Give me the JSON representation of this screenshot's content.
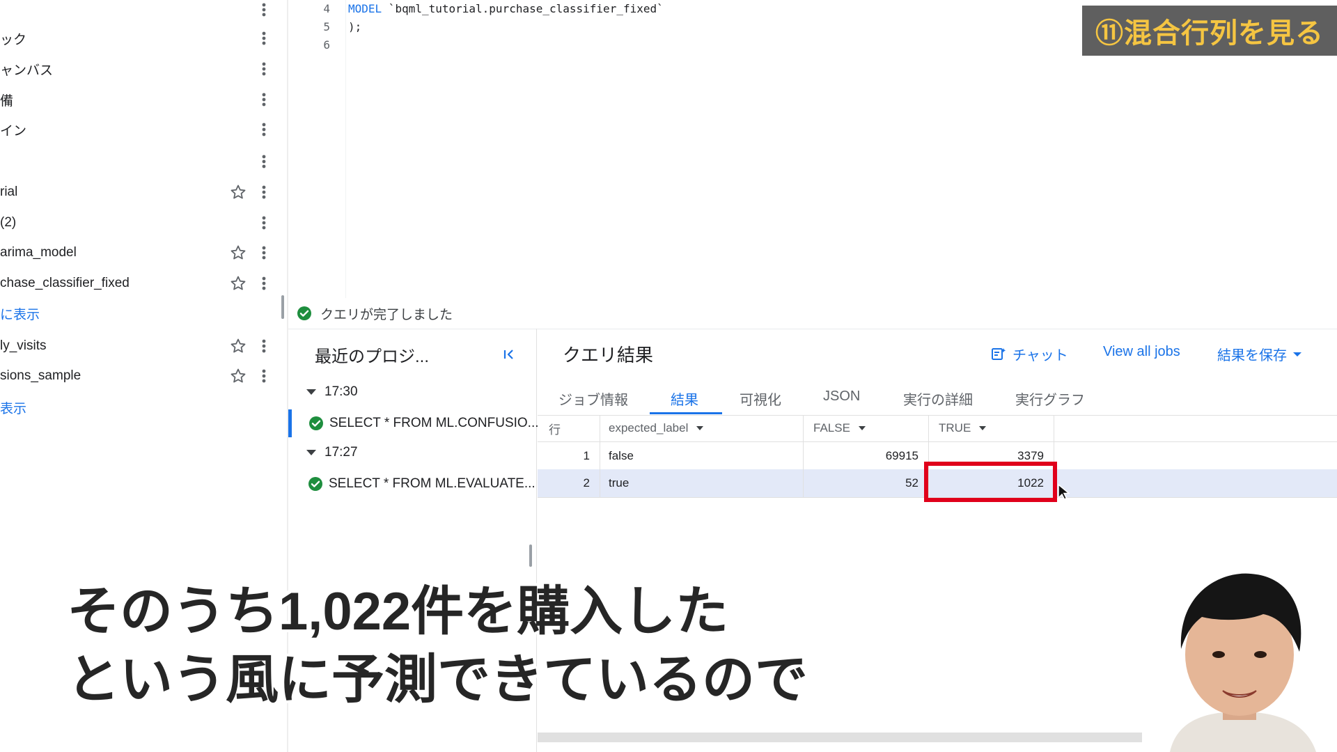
{
  "chapter_tag": "⑪混合行列を見る",
  "explorer": {
    "items": [
      {
        "label": "",
        "star": false
      },
      {
        "label": "ック",
        "star": false
      },
      {
        "label": "ャンバス",
        "star": false
      },
      {
        "label": "備",
        "star": false
      },
      {
        "label": "イン",
        "star": false
      },
      {
        "label": "",
        "star": false
      },
      {
        "label": "rial",
        "star": true
      },
      {
        "label": "(2)",
        "star": false
      },
      {
        "label": "arima_model",
        "star": true
      },
      {
        "label": "chase_classifier_fixed",
        "star": true
      },
      {
        "label": "に表示",
        "star": false,
        "link": true
      },
      {
        "label": "ly_visits",
        "star": true
      },
      {
        "label": "sions_sample",
        "star": true
      },
      {
        "label": "表示",
        "star": false,
        "link": true
      }
    ]
  },
  "editor": {
    "lines": [
      {
        "num": "4",
        "keyword": "MODEL",
        "text": " `bqml_tutorial.purchase_classifier_fixed`"
      },
      {
        "num": "5",
        "keyword": "",
        "text": ");"
      },
      {
        "num": "6",
        "keyword": "",
        "text": ""
      }
    ]
  },
  "status": {
    "text": "クエリが完了しました"
  },
  "recent": {
    "title": "最近のプロジ...",
    "groups": [
      {
        "time": "17:30",
        "job": "SELECT * FROM ML.CONFUSIO..."
      },
      {
        "time": "17:27",
        "job": "SELECT * FROM ML.EVALUATE..."
      }
    ]
  },
  "results": {
    "title": "クエリ結果",
    "chat_label": "チャット",
    "view_all_jobs": "View all jobs",
    "save_results": "結果を保存",
    "tabs": [
      "ジョブ情報",
      "結果",
      "可視化",
      "JSON",
      "実行の詳細",
      "実行グラフ"
    ],
    "active_tab": "結果",
    "columns": [
      "行",
      "expected_label",
      "FALSE",
      "TRUE"
    ],
    "rows": [
      {
        "row": "1",
        "expected_label": "false",
        "FALSE": "69915",
        "TRUE": "3379"
      },
      {
        "row": "2",
        "expected_label": "true",
        "FALSE": "52",
        "TRUE": "1022"
      }
    ]
  },
  "subtitle": {
    "line1": "そのうち1,022件を購入した",
    "line2": "という風に予測できているので"
  },
  "colors": {
    "accent": "#1a73e8",
    "highlight": "#e0001b",
    "success": "#1e8e3e",
    "chapter_text": "#f5c542",
    "chapter_bg": "#5f5f5f"
  }
}
